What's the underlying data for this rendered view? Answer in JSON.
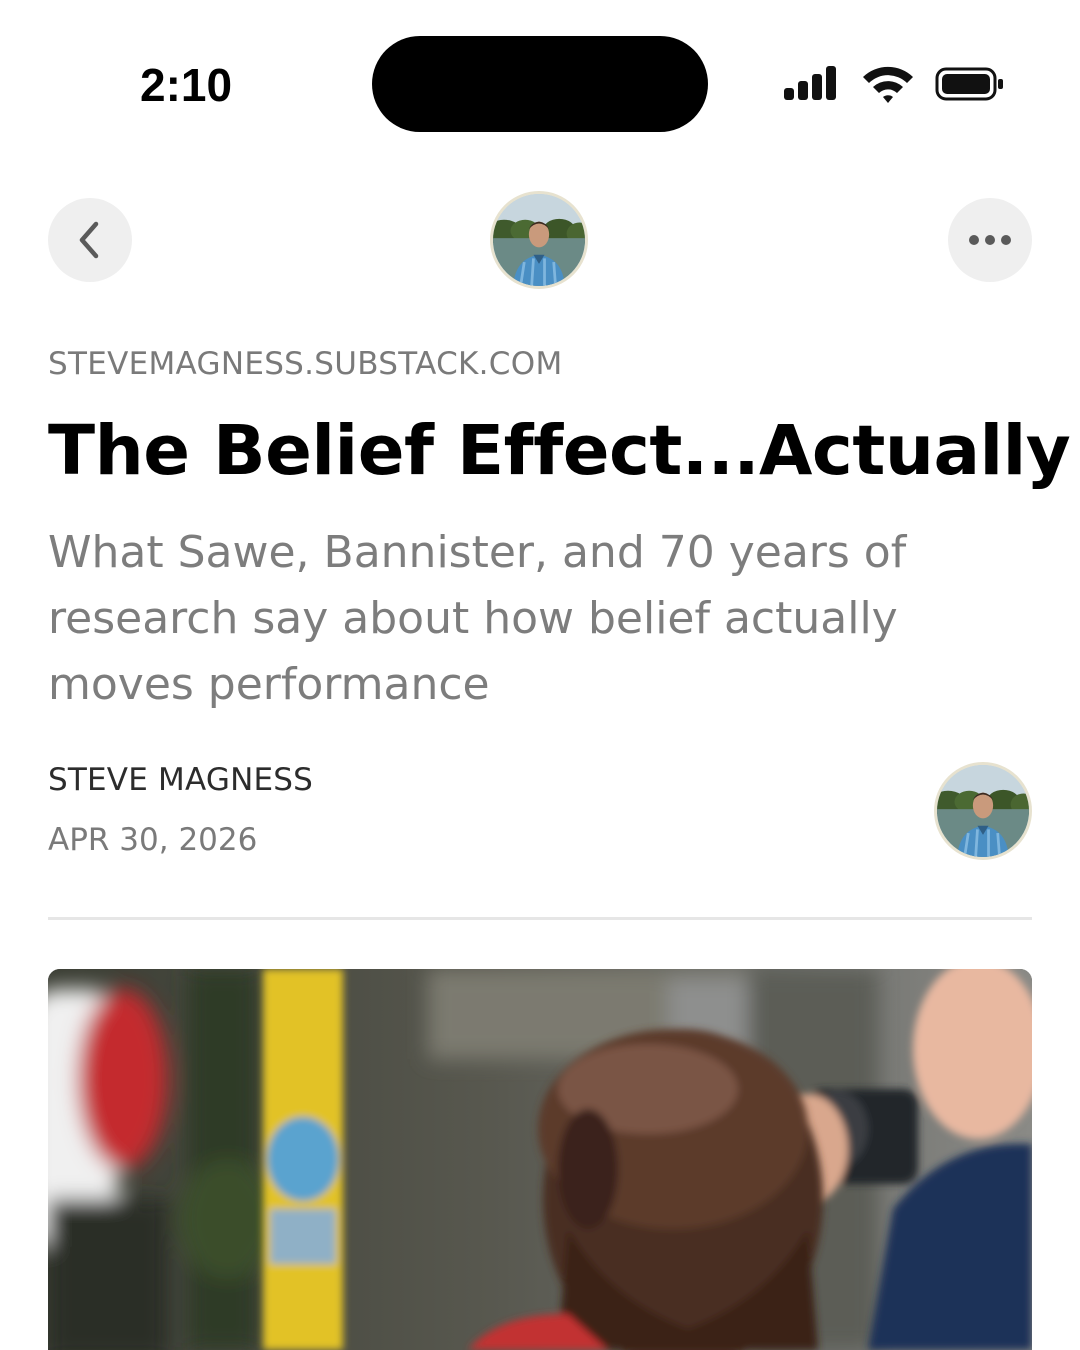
{
  "status_bar": {
    "time": "2:10",
    "icons": [
      "signal-icon",
      "wifi-icon",
      "battery-icon"
    ]
  },
  "nav": {
    "back_icon": "chevron-left-icon",
    "more_icon": "more-horizontal-icon",
    "avatar_alt": "author-avatar"
  },
  "article": {
    "publication": "STEVEMAGNESS.SUBSTACK.COM",
    "title": "The Belief Effect...Actually",
    "subtitle": "What Sawe, Bannister, and 70 years of research say about how belief actually moves performance",
    "author": "STEVE MAGNESS",
    "date": "APR 30, 2026"
  },
  "colors": {
    "background": "#ffffff",
    "nav_button": "#efefef",
    "meta_text": "#7a7a7a",
    "title_text": "#000000",
    "divider": "#e6e6e6"
  }
}
